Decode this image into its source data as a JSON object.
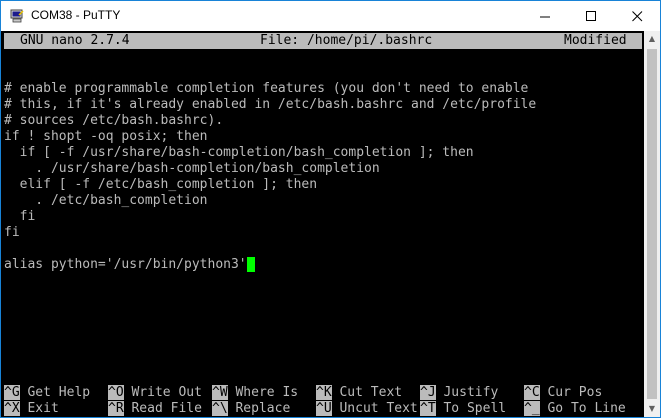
{
  "window": {
    "title": "COM38 - PuTTY",
    "controls": {
      "minimize": "—",
      "maximize": "☐",
      "close": "✕"
    }
  },
  "nano": {
    "version": "GNU nano 2.7.4",
    "file": "File: /home/pi/.bashrc",
    "status": "Modified"
  },
  "lines": [
    "# enable programmable completion features (you don't need to enable",
    "# this, if it's already enabled in /etc/bash.bashrc and /etc/profile",
    "# sources /etc/bash.bashrc).",
    "if ! shopt -oq posix; then",
    "  if [ -f /usr/share/bash-completion/bash_completion ]; then",
    "    . /usr/share/bash-completion/bash_completion",
    "  elif [ -f /etc/bash_completion ]; then",
    "    . /etc/bash_completion",
    "  fi",
    "fi",
    "",
    "alias python='/usr/bin/python3'"
  ],
  "shortcuts": {
    "row1": [
      {
        "key": "^G",
        "label": "Get Help"
      },
      {
        "key": "^O",
        "label": "Write Out"
      },
      {
        "key": "^W",
        "label": "Where Is"
      },
      {
        "key": "^K",
        "label": "Cut Text"
      },
      {
        "key": "^J",
        "label": "Justify"
      },
      {
        "key": "^C",
        "label": "Cur Pos"
      }
    ],
    "row2": [
      {
        "key": "^X",
        "label": "Exit"
      },
      {
        "key": "^R",
        "label": "Read File"
      },
      {
        "key": "^\\",
        "label": "Replace"
      },
      {
        "key": "^U",
        "label": "Uncut Text"
      },
      {
        "key": "^T",
        "label": "To Spell"
      },
      {
        "key": "^_",
        "label": "Go To Line"
      }
    ]
  },
  "colors": {
    "cursor": "#00ff00",
    "text": "#bbbbbb",
    "background": "#000000"
  }
}
